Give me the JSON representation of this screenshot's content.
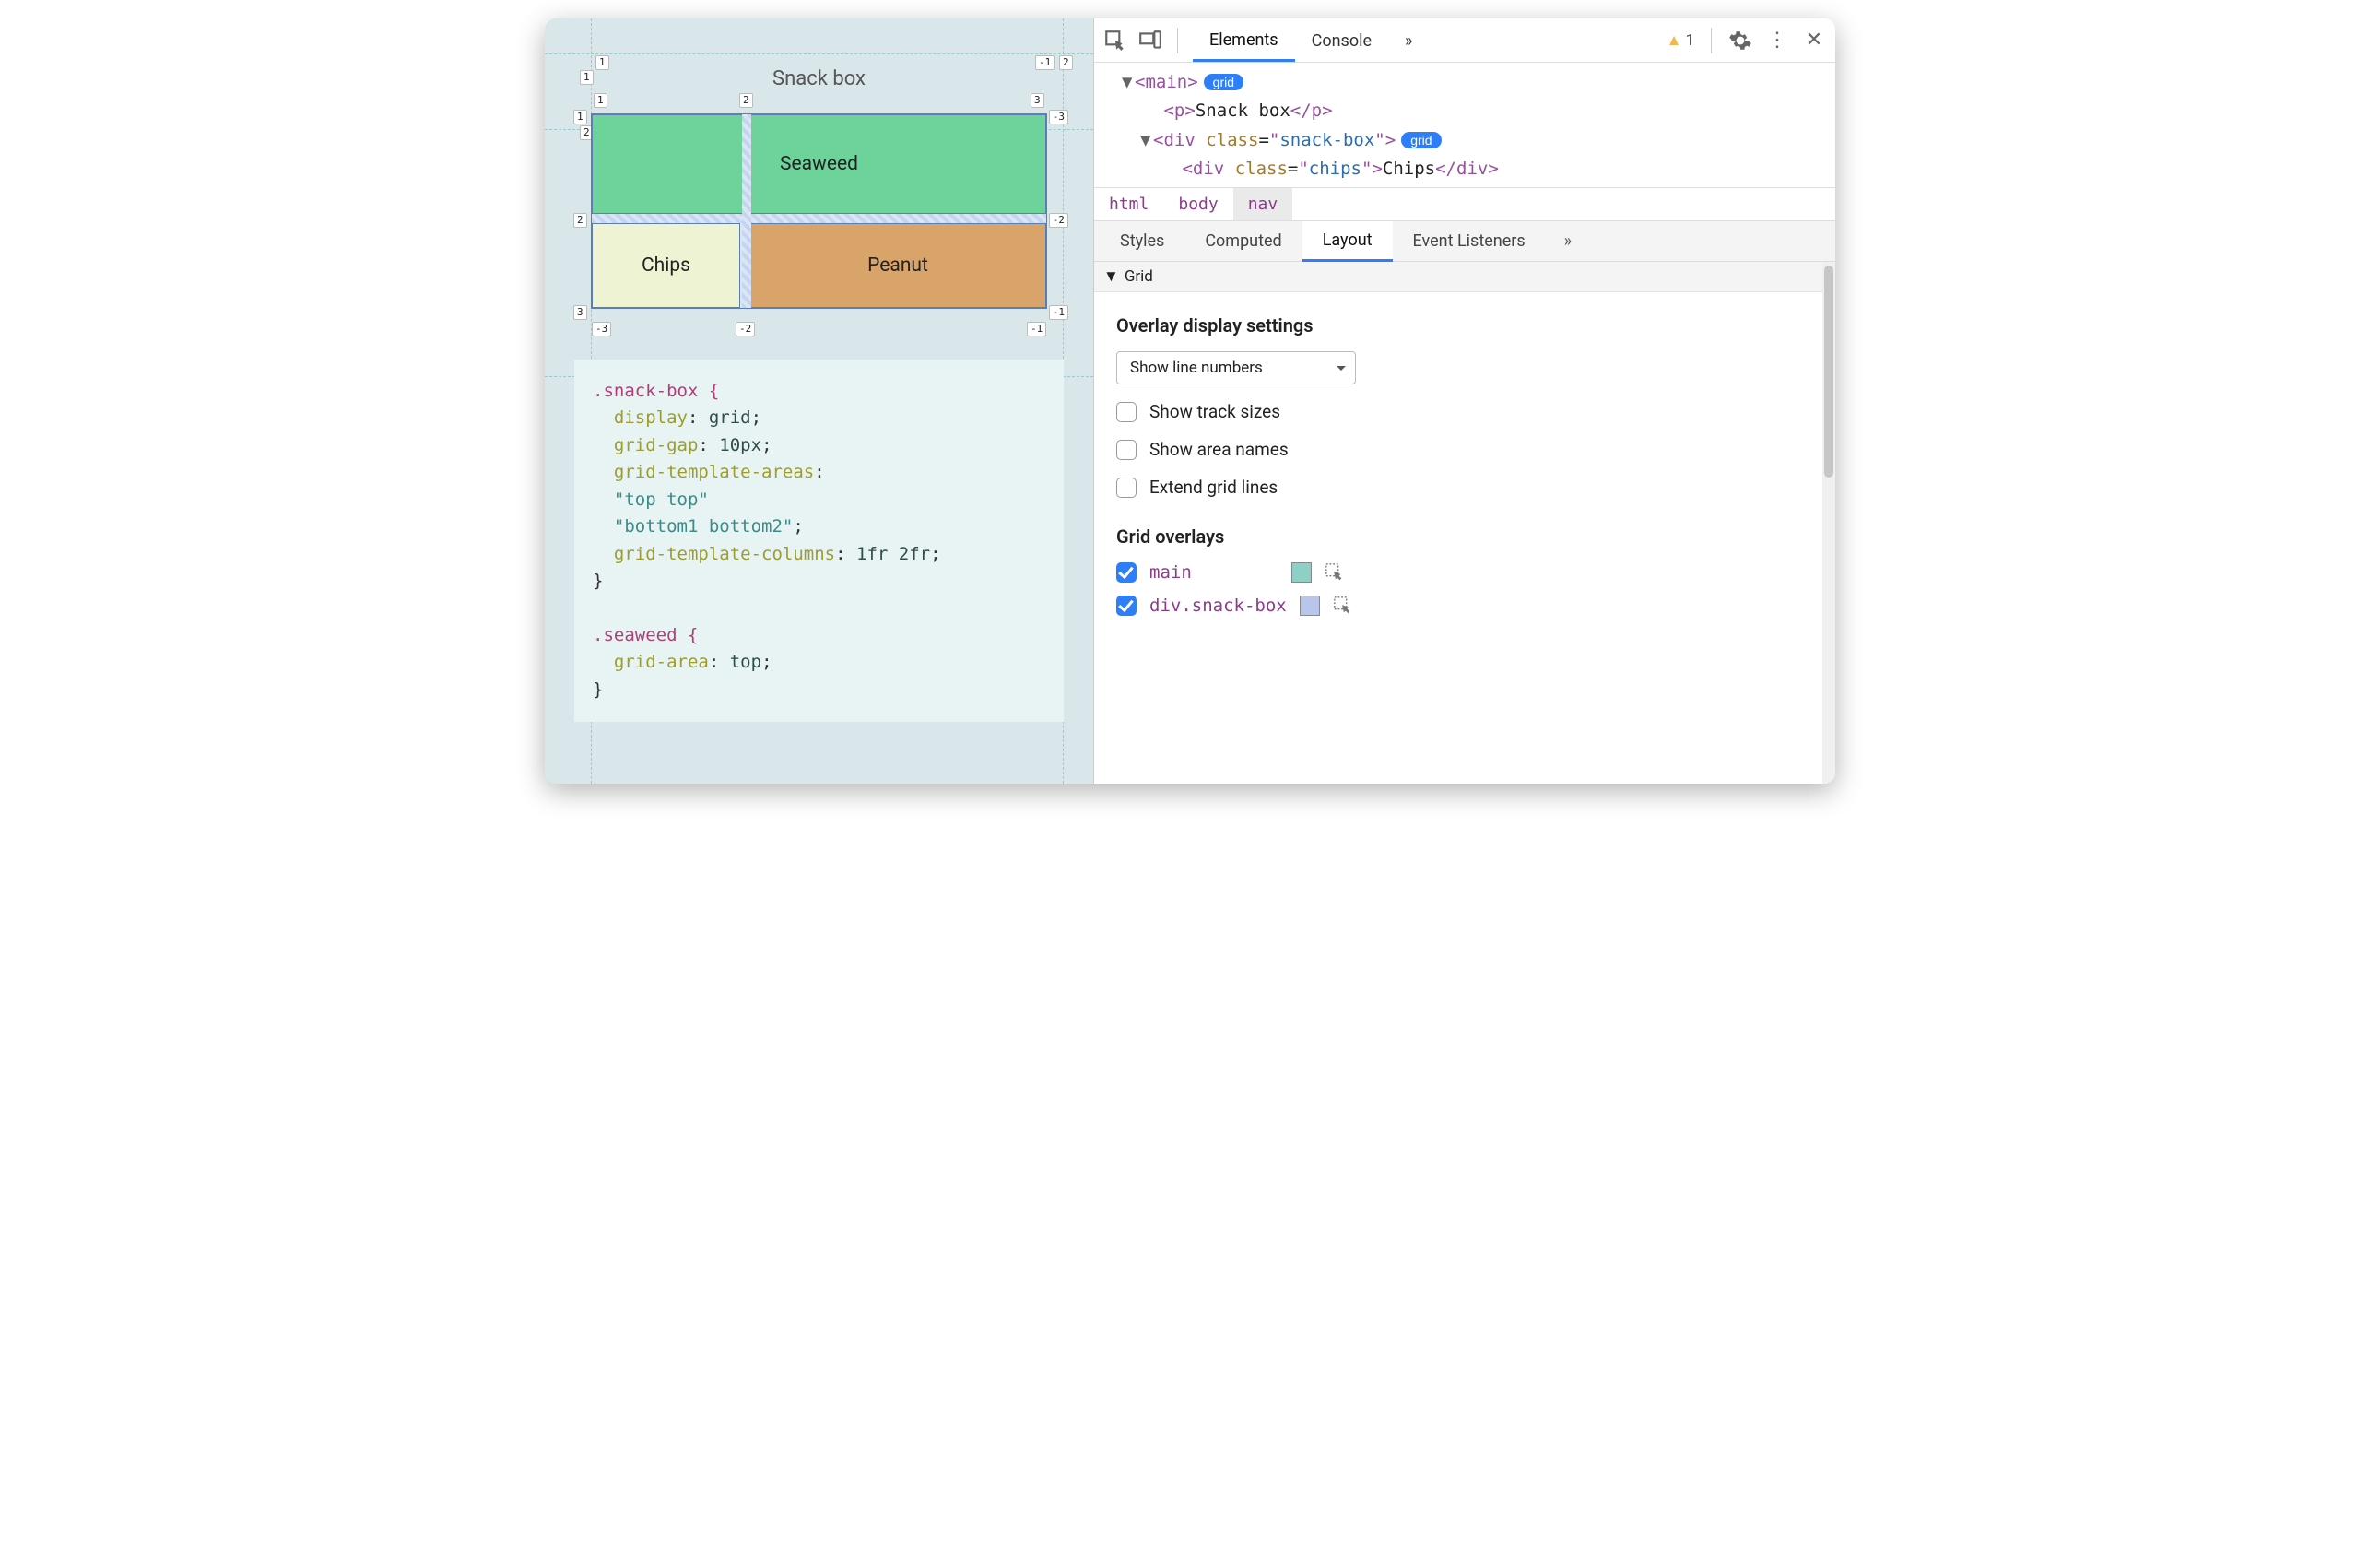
{
  "viewport": {
    "title": "Snack box",
    "cells": {
      "seaweed": "Seaweed",
      "chips": "Chips",
      "peanut": "Peanut"
    },
    "lineNumbers": {
      "outerTop": [
        "1",
        "-1",
        "2"
      ],
      "outerLeft": [
        "1",
        "2",
        "3"
      ],
      "innerTop": [
        "1",
        "2",
        "3"
      ],
      "innerTopRow": [
        "1",
        "-3"
      ],
      "innerMid": [
        "2",
        "-2"
      ],
      "innerBottom": [
        "3",
        "-1"
      ],
      "innerBottomNeg": [
        "-3",
        "-2",
        "-1"
      ]
    },
    "code": {
      "l1": ".snack-box {",
      "l2_prop": "display",
      "l2_val": "grid",
      "l3_prop": "grid-gap",
      "l3_val": "10px",
      "l4_prop": "grid-template-areas",
      "l5_str": "\"top top\"",
      "l6_str": "\"bottom1 bottom2\"",
      "l7_prop": "grid-template-columns",
      "l7_val": "1fr 2fr",
      "l8": "}",
      "l10": ".seaweed {",
      "l11_prop": "grid-area",
      "l11_val": "top",
      "l12": "}"
    }
  },
  "devtools": {
    "mainTabs": [
      "Elements",
      "Console"
    ],
    "warningCount": "1",
    "dom": {
      "line1_tag": "main",
      "line2_tag": "p",
      "line2_text": "Snack box",
      "line3_tag": "div",
      "line3_attr": "class",
      "line3_val": "snack-box",
      "line4_tag": "div",
      "line4_attr": "class",
      "line4_val": "chips",
      "line4_text": "Chips",
      "gridBadge": "grid"
    },
    "breadcrumb": [
      "html",
      "body",
      "nav"
    ],
    "subTabs": [
      "Styles",
      "Computed",
      "Layout",
      "Event Listeners"
    ],
    "gridSection": {
      "heading": "Grid",
      "overlayTitle": "Overlay display settings",
      "dropdown": "Show line numbers",
      "checks": [
        "Show track sizes",
        "Show area names",
        "Extend grid lines"
      ],
      "overlaysTitle": "Grid overlays",
      "overlays": [
        {
          "label": "main",
          "swatch": "#8FD0C6",
          "checked": true
        },
        {
          "label": "div.snack-box",
          "swatch": "#B8C6EC",
          "checked": true
        }
      ]
    }
  }
}
